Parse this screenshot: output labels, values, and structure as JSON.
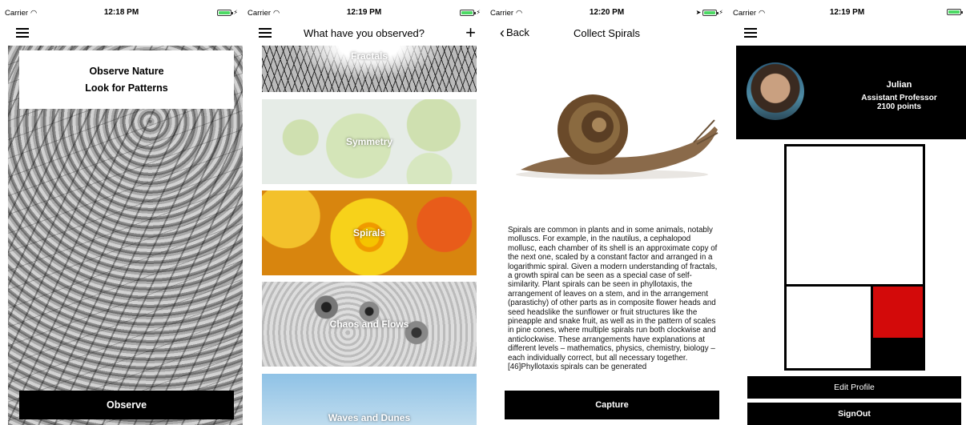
{
  "screens": {
    "observe": {
      "status": {
        "carrier": "Carrier",
        "time": "12:18 PM"
      },
      "intro_line1": "Observe Nature",
      "intro_line2": "Look for Patterns",
      "button": "Observe"
    },
    "categories": {
      "status": {
        "carrier": "Carrier",
        "time": "12:19 PM"
      },
      "title": "What have you observed?",
      "add_icon": "+",
      "items": [
        {
          "label": "Fractals"
        },
        {
          "label": "Symmetry"
        },
        {
          "label": "Spirals"
        },
        {
          "label": "Chaos and Flows"
        },
        {
          "label": "Waves and Dunes"
        }
      ]
    },
    "detail": {
      "status": {
        "carrier": "Carrier",
        "time": "12:20 PM"
      },
      "back": "Back",
      "title": "Collect Spirals",
      "body": "Spirals are common in plants and in some animals, notably molluscs. For example, in the nautilus, a cephalopod mollusc, each chamber of its shell is an approximate copy of the next one, scaled by a constant factor and arranged in a logarithmic spiral. Given a modern understanding of fractals, a growth spiral can be seen as a special case of self-similarity. Plant spirals can be seen in phyllotaxis, the arrangement of leaves on a stem, and in the arrangement (parastichy) of other parts as in composite flower heads and seed headslike the sunflower or fruit structures like the pineapple and snake fruit, as well as in the pattern of scales in pine cones, where multiple spirals run both clockwise and anticlockwise. These arrangements have explanations at different levels – mathematics, physics, chemistry, biology – each individually correct, but all necessary together.[46]Phyllotaxis spirals can be generated",
      "button": "Capture"
    },
    "profile": {
      "status": {
        "carrier": "Carrier",
        "time": "12:19 PM"
      },
      "name": "Julian",
      "role": "Assistant Professor",
      "points": "2100 points",
      "edit_button": "Edit Profile",
      "signout_button": "SignOut"
    }
  },
  "colors": {
    "battery": "#4cd964",
    "mondrian_red": "#d30a0a"
  },
  "icons": [
    "wifi-icon",
    "battery-icon",
    "menu-icon",
    "plus-icon",
    "back-chevron-icon",
    "location-arrow-icon"
  ]
}
